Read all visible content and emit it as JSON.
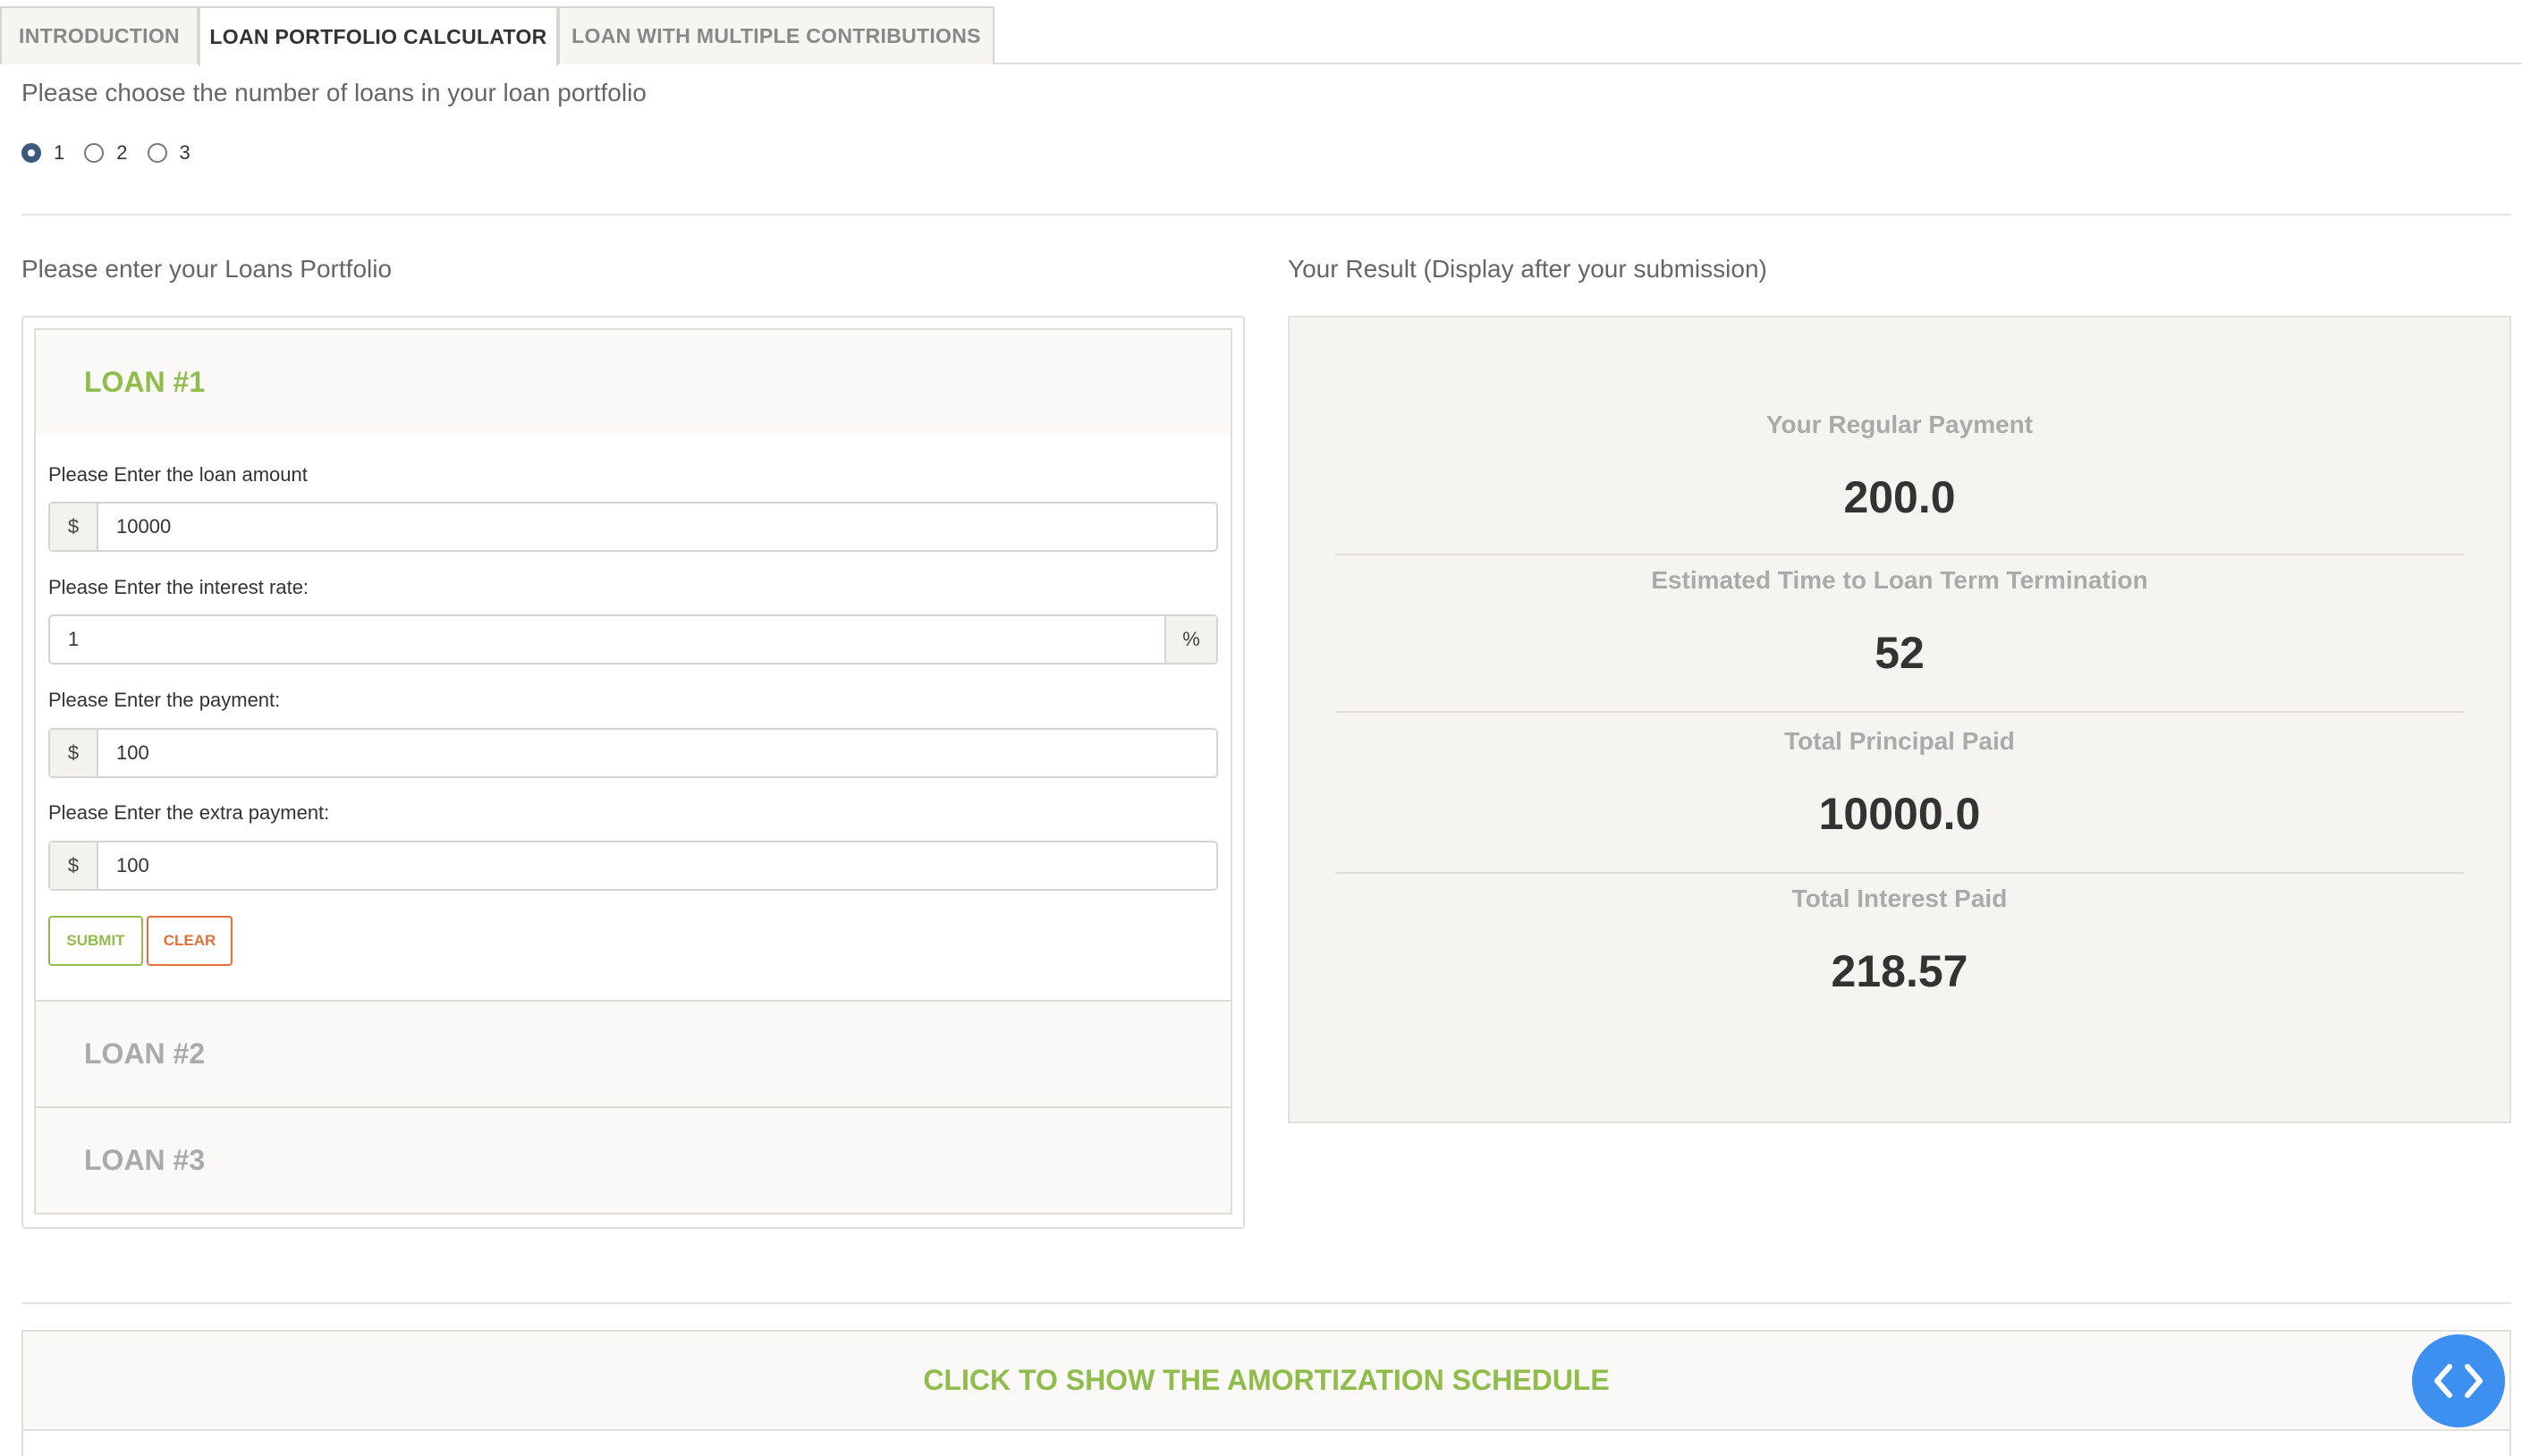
{
  "tabs": [
    {
      "label": "INTRODUCTION"
    },
    {
      "label": "LOAN PORTFOLIO CALCULATOR"
    },
    {
      "label": "LOAN WITH MULTIPLE CONTRIBUTIONS"
    }
  ],
  "active_tab": "LOAN PORTFOLIO CALCULATOR",
  "loan_count": {
    "prompt": "Please choose the number of loans in your loan portfolio",
    "options": [
      "1",
      "2",
      "3"
    ],
    "selected": "1"
  },
  "portfolio": {
    "heading": "Please enter your Loans Portfolio",
    "loans": [
      {
        "title": "LOAN #1"
      },
      {
        "title": "LOAN #2"
      },
      {
        "title": "LOAN #3"
      }
    ],
    "form": {
      "amount_label": "Please Enter the loan amount",
      "amount_prefix": "$",
      "amount_value": "10000",
      "rate_label": "Please Enter the interest rate:",
      "rate_value": "1",
      "rate_suffix": "%",
      "payment_label": "Please Enter the payment:",
      "payment_prefix": "$",
      "payment_value": "100",
      "extra_label": "Please Enter the extra payment:",
      "extra_prefix": "$",
      "extra_value": "100",
      "submit_label": "SUBMIT",
      "clear_label": "CLEAR"
    }
  },
  "result": {
    "heading": "Your Result (Display after your submission)",
    "regular_payment_label": "Your Regular Payment",
    "regular_payment_value": "200.0",
    "term_label": "Estimated Time to Loan Term Termination",
    "term_value": "52",
    "principal_label": "Total Principal Paid",
    "principal_value": "10000.0",
    "interest_label": "Total Interest Paid",
    "interest_value": "218.57"
  },
  "amortization": {
    "label": "CLICK TO SHOW THE AMORTIZATION SCHEDULE"
  },
  "colors": {
    "accent_green": "#8fbc4a",
    "clear_orange": "#e0703a",
    "code_button_blue": "#3d8ff0"
  }
}
